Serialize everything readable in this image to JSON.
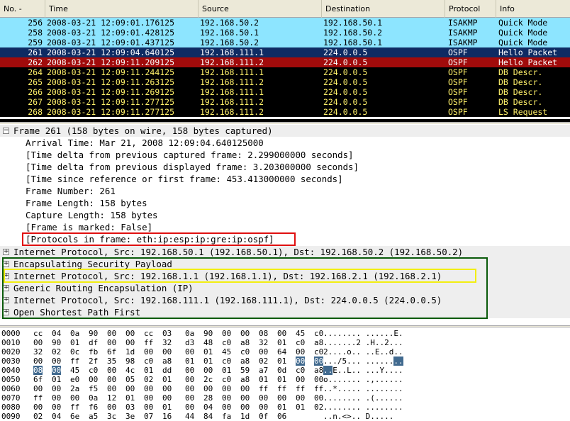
{
  "columns": {
    "no": "No. -",
    "sort_icon": "chevron-down-icon",
    "time": "Time",
    "source": "Source",
    "destination": "Destination",
    "protocol": "Protocol",
    "info": "Info"
  },
  "packets": [
    {
      "no": "256",
      "time": "2008-03-21 12:09:01.176125",
      "source": "192.168.50.2",
      "destination": "192.168.50.1",
      "protocol": "ISAKMP",
      "info": "Quick Mode",
      "bg": "#8de5ff",
      "fg": "#000000"
    },
    {
      "no": "258",
      "time": "2008-03-21 12:09:01.428125",
      "source": "192.168.50.1",
      "destination": "192.168.50.2",
      "protocol": "ISAKMP",
      "info": "Quick Mode",
      "bg": "#8de5ff",
      "fg": "#000000"
    },
    {
      "no": "259",
      "time": "2008-03-21 12:09:01.437125",
      "source": "192.168.50.2",
      "destination": "192.168.50.1",
      "protocol": "ISAKMP",
      "info": "Quick Mode",
      "bg": "#8de5ff",
      "fg": "#000000"
    },
    {
      "no": "261",
      "time": "2008-03-21 12:09:04.640125",
      "source": "192.168.111.1",
      "destination": "224.0.0.5",
      "protocol": "OSPF",
      "info": "Hello Packet",
      "bg": "#0e2b63",
      "fg": "#ffffff"
    },
    {
      "no": "262",
      "time": "2008-03-21 12:09:11.209125",
      "source": "192.168.111.2",
      "destination": "224.0.0.5",
      "protocol": "OSPF",
      "info": "Hello Packet",
      "bg": "#a10b0b",
      "fg": "#ffffff"
    },
    {
      "no": "264",
      "time": "2008-03-21 12:09:11.244125",
      "source": "192.168.111.1",
      "destination": "224.0.0.5",
      "protocol": "OSPF",
      "info": "DB Descr.",
      "bg": "#000000",
      "fg": "#fff06a"
    },
    {
      "no": "265",
      "time": "2008-03-21 12:09:11.263125",
      "source": "192.168.111.2",
      "destination": "224.0.0.5",
      "protocol": "OSPF",
      "info": "DB Descr.",
      "bg": "#000000",
      "fg": "#fff06a"
    },
    {
      "no": "266",
      "time": "2008-03-21 12:09:11.269125",
      "source": "192.168.111.1",
      "destination": "224.0.0.5",
      "protocol": "OSPF",
      "info": "DB Descr.",
      "bg": "#000000",
      "fg": "#fff06a"
    },
    {
      "no": "267",
      "time": "2008-03-21 12:09:11.277125",
      "source": "192.168.111.2",
      "destination": "224.0.0.5",
      "protocol": "OSPF",
      "info": "DB Descr.",
      "bg": "#000000",
      "fg": "#fff06a"
    },
    {
      "no": "268",
      "time": "2008-03-21 12:09:11.277125",
      "source": "192.168.111.2",
      "destination": "224.0.0.5",
      "protocol": "OSPF",
      "info": "LS Request",
      "bg": "#000000",
      "fg": "#fff06a"
    }
  ],
  "details": [
    {
      "expander": "−",
      "expander_icon": "collapse-icon",
      "text": "Frame 261 (158 bytes on wire, 158 bytes captured)",
      "indent": 0,
      "shaded": true
    },
    {
      "text": "Arrival Time: Mar 21, 2008 12:09:04.640125000",
      "indent": 1
    },
    {
      "text": "[Time delta from previous captured frame: 2.299000000 seconds]",
      "indent": 1
    },
    {
      "text": "[Time delta from previous displayed frame: 3.203000000 seconds]",
      "indent": 1
    },
    {
      "text": "[Time since reference or first frame: 453.413000000 seconds]",
      "indent": 1
    },
    {
      "text": "Frame Number: 261",
      "indent": 1
    },
    {
      "text": "Frame Length: 158 bytes",
      "indent": 1
    },
    {
      "text": "Capture Length: 158 bytes",
      "indent": 1
    },
    {
      "text": "[Frame is marked: False]",
      "indent": 1
    },
    {
      "text": "[Protocols in frame: eth:ip:esp:ip:gre:ip:ospf]",
      "indent": 1
    },
    {
      "expander": "+",
      "expander_icon": "expand-icon",
      "text": "Internet Protocol, Src: 192.168.50.1 (192.168.50.1), Dst: 192.168.50.2 (192.168.50.2)",
      "indent": 0,
      "shaded": true
    },
    {
      "expander": "+",
      "expander_icon": "expand-icon",
      "text": "Encapsulating Security Payload",
      "indent": 0,
      "shaded": true
    },
    {
      "expander": "+",
      "expander_icon": "expand-icon",
      "text": "Internet Protocol, Src: 192.168.1.1 (192.168.1.1), Dst: 192.168.2.1 (192.168.2.1)",
      "indent": 0,
      "shaded": true
    },
    {
      "expander": "+",
      "expander_icon": "expand-icon",
      "text": "Generic Routing Encapsulation (IP)",
      "indent": 0,
      "shaded": true
    },
    {
      "expander": "+",
      "expander_icon": "expand-icon",
      "text": "Internet Protocol, Src: 192.168.111.1 (192.168.111.1), Dst: 224.0.0.5 (224.0.0.5)",
      "indent": 0,
      "shaded": true
    },
    {
      "expander": "+",
      "expander_icon": "expand-icon",
      "text": "Open Shortest Path First",
      "indent": 0,
      "shaded": true
    }
  ],
  "hex": [
    {
      "offset": "0000",
      "bytes": [
        "cc",
        "04",
        "0a",
        "90",
        "00",
        "00",
        "cc",
        "03",
        "0a",
        "90",
        "00",
        "00",
        "08",
        "00",
        "45",
        "c0"
      ],
      "ascii": "........ ......E."
    },
    {
      "offset": "0010",
      "bytes": [
        "00",
        "90",
        "01",
        "df",
        "00",
        "00",
        "ff",
        "32",
        "d3",
        "48",
        "c0",
        "a8",
        "32",
        "01",
        "c0",
        "a8"
      ],
      "ascii": ".......2 .H..2..."
    },
    {
      "offset": "0020",
      "bytes": [
        "32",
        "02",
        "0c",
        "fb",
        "6f",
        "1d",
        "00",
        "00",
        "00",
        "01",
        "45",
        "c0",
        "00",
        "64",
        "00",
        "c0"
      ],
      "ascii": "2....o.. ..E..d.."
    },
    {
      "offset": "0030",
      "bytes": [
        "00",
        "00",
        "ff",
        "2f",
        "35",
        "98",
        "c0",
        "a8",
        "01",
        "01",
        "c0",
        "a8",
        "02",
        "01",
        "00",
        "00"
      ],
      "ascii": ".../5... ........"
    },
    {
      "offset": "0040",
      "bytes": [
        "08",
        "00",
        "45",
        "c0",
        "00",
        "4c",
        "01",
        "dd",
        "00",
        "00",
        "01",
        "59",
        "a7",
        "0d",
        "c0",
        "a8"
      ],
      "ascii": "..E..L.. ...Y...."
    },
    {
      "offset": "0050",
      "bytes": [
        "6f",
        "01",
        "e0",
        "00",
        "00",
        "05",
        "02",
        "01",
        "00",
        "2c",
        "c0",
        "a8",
        "01",
        "01",
        "00",
        "00"
      ],
      "ascii": "o....... .,......"
    },
    {
      "offset": "0060",
      "bytes": [
        "00",
        "00",
        "2a",
        "f5",
        "00",
        "00",
        "00",
        "00",
        "00",
        "00",
        "00",
        "00",
        "ff",
        "ff",
        "ff",
        "ff"
      ],
      "ascii": "..*..... ........"
    },
    {
      "offset": "0070",
      "bytes": [
        "ff",
        "00",
        "00",
        "0a",
        "12",
        "01",
        "00",
        "00",
        "00",
        "28",
        "00",
        "00",
        "00",
        "00",
        "00",
        "00"
      ],
      "ascii": "........ .(......"
    },
    {
      "offset": "0080",
      "bytes": [
        "00",
        "00",
        "ff",
        "f6",
        "00",
        "03",
        "00",
        "01",
        "00",
        "04",
        "00",
        "00",
        "00",
        "01",
        "01",
        "02"
      ],
      "ascii": "........ ........"
    },
    {
      "offset": "0090",
      "bytes": [
        "02",
        "04",
        "6e",
        "a5",
        "3c",
        "3e",
        "07",
        "16",
        "44",
        "84",
        "fa",
        "1d",
        "0f",
        "06"
      ],
      "ascii": "..n.<>.. D....."
    }
  ],
  "hex_highlight_note": "bytes 0x003e-0x0041 highlighted",
  "colors": {
    "isakmp_bg": "#8de5ff",
    "selected_bg": "#0e2b63",
    "bad_hello_bg": "#a10b0b",
    "ospf_fg": "#fff06a",
    "highlight_red": "#e01010",
    "highlight_yellow": "#f2ee10",
    "highlight_green": "#0a5a0a",
    "hex_select": "#416a8f"
  }
}
